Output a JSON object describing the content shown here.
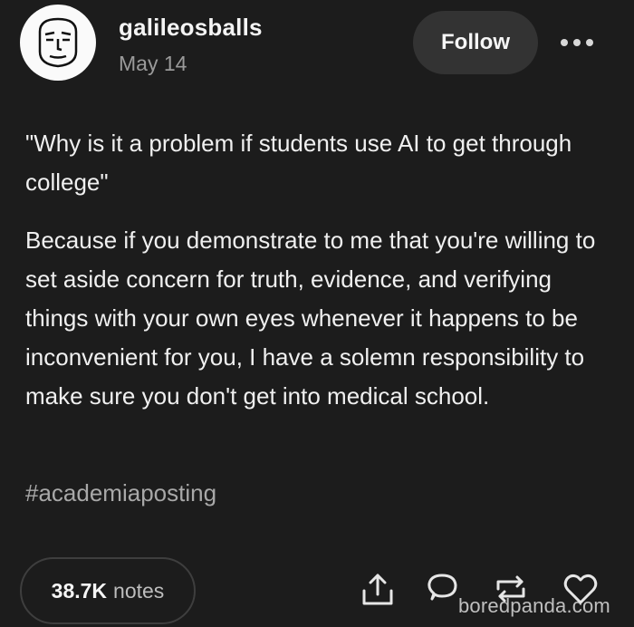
{
  "post": {
    "username": "galileosballs",
    "date": "May 14",
    "follow_label": "Follow",
    "more_icon": "ellipsis-icon",
    "quote": "\"Why is it a problem if students use AI to get through college\"",
    "body": "Because if you demonstrate to me that you're willing to set aside concern for truth, evidence, and verifying things with your own eyes whenever it happens to be inconvenient for you, I have a solemn responsibility to make sure you don't get into medical school.",
    "tag": "#academiaposting"
  },
  "footer": {
    "notes_count": "38.7K",
    "notes_label": "notes",
    "icons": [
      "share-icon",
      "reply-icon",
      "reblog-icon",
      "like-icon"
    ]
  },
  "watermark": "boredpanda.com",
  "colors": {
    "background": "#1c1c1c",
    "button_bg": "#333333",
    "text": "#f0f0f0",
    "muted": "#9a9a9a"
  }
}
